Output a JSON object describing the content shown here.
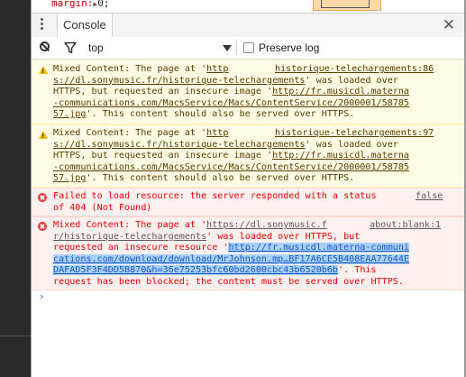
{
  "elements_top": {
    "code_prop": "margin:",
    "code_arrow": "▶",
    "code_value": "0;"
  },
  "drawer": {
    "tab_label": "Console",
    "close_icon": "close-icon",
    "menu_icon": "more-vertical-icon"
  },
  "toolbar": {
    "context_value": "top",
    "preserve_log_label": "Preserve log",
    "preserve_log_checked": false
  },
  "messages": [
    {
      "level": "warning",
      "lines": [
        [
          "Mixed Content: The page at '",
          "http"
        ],
        [
          "s://dl.sonymusic.fr/historique-telechargements",
          "' was loaded over"
        ],
        [
          "HTTPS, but requested an insecure image '",
          "http://fr.musicdl.materna"
        ],
        [
          "-communications.com/MacsService/Macs/ContentService/2000001/58785"
        ],
        [
          "57.jpg",
          "'. This content should also be served over HTTPS."
        ]
      ],
      "source": "historique-telechargements:86"
    },
    {
      "level": "warning",
      "lines": [
        [
          "Mixed Content: The page at '",
          "http"
        ],
        [
          "s://dl.sonymusic.fr/historique-telechargements",
          "' was loaded over"
        ],
        [
          "HTTPS, but requested an insecure image '",
          "http://fr.musicdl.materna"
        ],
        [
          "-communications.com/MacsService/Macs/ContentService/2000001/58785"
        ],
        [
          "57.jpg",
          "'. This content should also be served over HTTPS."
        ]
      ],
      "source": "historique-telechargements:97"
    },
    {
      "level": "error",
      "lines": [
        [
          "Failed to load resource: the server responded with a status"
        ],
        [
          "of 404 (Not Found)"
        ]
      ],
      "source": "false"
    },
    {
      "level": "error",
      "lines": [
        [
          "Mixed Content: The page at '",
          "https://dl.sonymusic.f"
        ],
        [
          "r/historique-telechargements",
          "' was loaded over HTTPS, but"
        ],
        [
          "requested an insecure resource '",
          "http://fr.musicdl.materna-communi"
        ],
        [
          "cations.com/download/download/MrJohnson.mp…BF17A6CE5B408EAA77644E"
        ],
        [
          "DAFAD5F3F4DD5B870&h=36e75253bfc60bd2600cbc43b6520b6b",
          "'. This"
        ],
        [
          "request has been blocked; the content must be served over HTTPS."
        ]
      ],
      "source": "about:blank:1"
    }
  ],
  "prompt": {
    "symbol": "›"
  },
  "colors": {
    "warning_bg": "#fffbe5",
    "warning_text": "#5c3c00",
    "error_bg": "#fff0f0",
    "error_text": "#ff0000",
    "selection": "#a8d1ff",
    "prompt": "#367cf1"
  }
}
